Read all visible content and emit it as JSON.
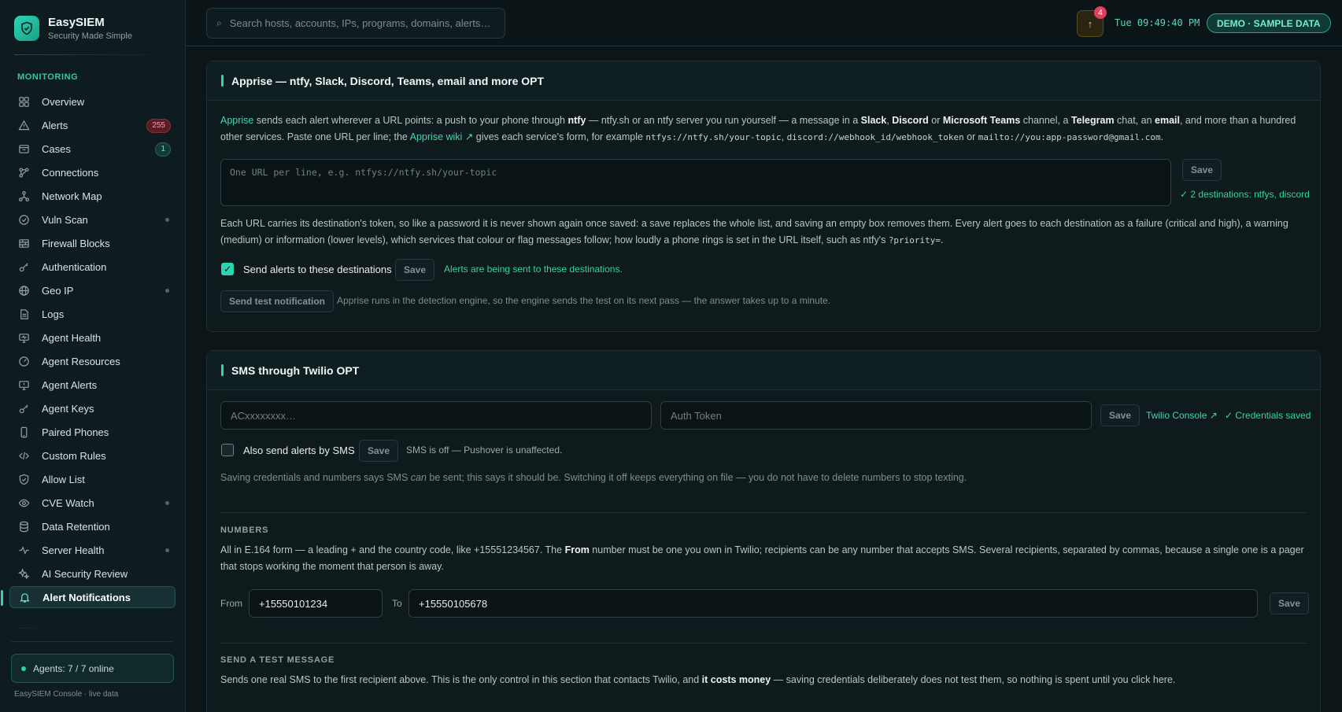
{
  "brand": {
    "name": "EasySIEM",
    "tagline": "Security Made Simple"
  },
  "sidebar": {
    "section_label": "MONITORING",
    "items": [
      {
        "label": "Overview",
        "icon": "grid-icon"
      },
      {
        "label": "Alerts",
        "icon": "warning-icon",
        "badge": "255"
      },
      {
        "label": "Cases",
        "icon": "folder-icon",
        "badge": "1"
      },
      {
        "label": "Connections",
        "icon": "connections-icon"
      },
      {
        "label": "Network Map",
        "icon": "network-icon"
      },
      {
        "label": "Vuln Scan",
        "icon": "scan-icon"
      },
      {
        "label": "Firewall Blocks",
        "icon": "firewall-icon"
      },
      {
        "label": "Authentication",
        "icon": "key-icon"
      },
      {
        "label": "Geo IP",
        "icon": "globe-icon"
      },
      {
        "label": "Logs",
        "icon": "document-icon"
      },
      {
        "label": "Agent Health",
        "icon": "monitor-icon"
      },
      {
        "label": "Agent Resources",
        "icon": "gauge-icon"
      },
      {
        "label": "Agent Alerts",
        "icon": "monitor-alert-icon"
      },
      {
        "label": "Agent Keys",
        "icon": "key-icon"
      },
      {
        "label": "Paired Phones",
        "icon": "phone-icon"
      },
      {
        "label": "Custom Rules",
        "icon": "code-icon"
      },
      {
        "label": "Allow List",
        "icon": "shield-icon"
      },
      {
        "label": "CVE Watch",
        "icon": "eye-icon"
      },
      {
        "label": "Data Retention",
        "icon": "database-icon"
      },
      {
        "label": "Server Health",
        "icon": "pulse-icon"
      },
      {
        "label": "AI Security Review",
        "icon": "sparkle-icon"
      },
      {
        "label": "Alert Notifications",
        "icon": "bell-icon"
      }
    ],
    "agents_status": "Agents: 7 / 7 online",
    "footer": "EasySIEM Console · live data"
  },
  "topbar": {
    "search_placeholder": "Search hosts, accounts, IPs, programs, domains, alerts…",
    "notification_count": "4",
    "clock": "Tue 09:49:40 PM",
    "demo_label": "DEMO · SAMPLE DATA"
  },
  "apprise": {
    "title": "Apprise — ntfy, Slack, Discord, Teams, email and more OPT",
    "intro": {
      "link1": "Apprise",
      "t1": " sends each alert wherever a URL points: a push to your phone through ",
      "b_ntfy": "ntfy",
      "t2": " — ntfy.sh or an ntfy server you run yourself — a message in a ",
      "b_slack": "Slack",
      "t3": ", ",
      "b_discord": "Discord",
      "t4": " or ",
      "b_teams": "Microsoft Teams",
      "t5": " channel, a ",
      "b_telegram": "Telegram",
      "t6": " chat, an ",
      "b_email": "email",
      "t7": ", and more than a hundred other services. Paste one URL per line; the ",
      "link2": "Apprise wiki ↗",
      "t8": " gives each service's form, for example ",
      "c1": "ntfys://ntfy.sh/your-topic",
      "t9": ", ",
      "c2": "discord://webhook_id/webhook_token",
      "t10": " or ",
      "c3": "mailto://you:app-password@gmail.com",
      "t11": "."
    },
    "urls_placeholder": "One URL per line, e.g. ntfys://ntfy.sh/your-topic",
    "save_label": "Save",
    "destinations_status": "✓ 2 destinations: ntfys, discord",
    "token_note": {
      "t1": "Each URL carries its destination's token, so like a password it is never shown again once saved: a save replaces the whole list, and saving an empty box removes them. Every alert goes to each destination as a failure (critical and high), a warning (medium) or information (lower levels), which services that colour or flag messages follow; how loudly a phone rings is set in the URL itself, such as ntfy's ",
      "c1": "?priority=",
      "t2": "."
    },
    "send_alerts_label": "Send alerts to these destinations",
    "send_alerts_checked": true,
    "send_alerts_save": "Save",
    "send_alerts_status": "Alerts are being sent to these destinations.",
    "test_button": "Send test notification",
    "test_note": "Apprise runs in the detection engine, so the engine sends the test on its next pass — the answer takes up to a minute."
  },
  "twilio": {
    "title": "SMS through Twilio OPT",
    "sid_placeholder": "ACxxxxxxxx…",
    "token_placeholder": "Auth Token",
    "save_label": "Save",
    "console_link": "Twilio Console ↗",
    "credentials_status": "✓ Credentials saved",
    "sms_label": "Also send alerts by SMS",
    "sms_checked": false,
    "sms_save": "Save",
    "sms_status": "SMS is off — Pushover is unaffected.",
    "sms_note": {
      "t1": "Saving credentials and numbers says SMS ",
      "i1": "can",
      "t2": " be sent; this says it should be. Switching it off keeps everything on file — you do not have to delete numbers to stop texting."
    },
    "numbers_heading": "NUMBERS",
    "numbers_note": {
      "t1": "All in E.164 form — a leading + and the country code, like +15551234567. The ",
      "b1": "From",
      "t2": " number must be one you own in Twilio; recipients can be any number that accepts SMS. Several recipients, separated by commas, because a single one is a pager that stops working the moment that person is away."
    },
    "from_label": "From",
    "from_value": "+15550101234",
    "to_label": "To",
    "to_value": "+15550105678",
    "numbers_save": "Save",
    "test_heading": "SEND A TEST MESSAGE",
    "test_note": {
      "t1": "Sends one real SMS to the first recipient above. This is the only control in this section that contacts Twilio, and ",
      "b1": "it costs money",
      "t2": " — saving credentials deliberately does not test them, so nothing is spent until you click here."
    }
  },
  "colors": {
    "accent": "#2dd4b4",
    "background": "#0c1618",
    "alert_badge": "#5a1c26"
  }
}
